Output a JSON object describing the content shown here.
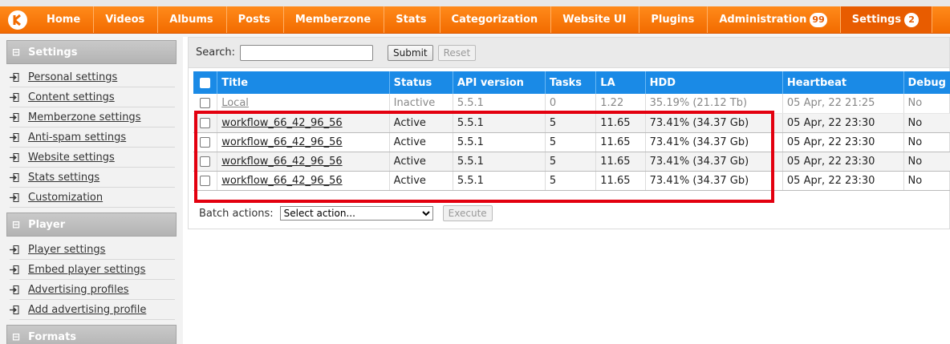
{
  "nav": {
    "items": [
      {
        "label": "Home"
      },
      {
        "label": "Videos"
      },
      {
        "label": "Albums"
      },
      {
        "label": "Posts"
      },
      {
        "label": "Memberzone"
      },
      {
        "label": "Stats"
      },
      {
        "label": "Categorization"
      },
      {
        "label": "Website UI"
      },
      {
        "label": "Plugins"
      },
      {
        "label": "Administration",
        "badge": "99"
      },
      {
        "label": "Settings",
        "badge": "2"
      }
    ]
  },
  "sidebar": {
    "sections": [
      {
        "title": "Settings",
        "toggle": "⊟",
        "links": [
          "Personal settings",
          "Content settings",
          "Memberzone settings",
          "Anti-spam settings",
          "Website settings",
          "Stats settings",
          "Customization"
        ]
      },
      {
        "title": "Player",
        "toggle": "⊟",
        "links": [
          "Player settings",
          "Embed player settings",
          "Advertising profiles",
          "Add advertising profile"
        ]
      },
      {
        "title": "Formats",
        "toggle": "⊟",
        "links": []
      }
    ]
  },
  "search": {
    "label": "Search:",
    "value": "",
    "submit": "Submit",
    "reset": "Reset"
  },
  "table": {
    "columns": [
      "Title",
      "Status",
      "API version",
      "Tasks",
      "LA",
      "HDD",
      "Heartbeat",
      "Debug"
    ],
    "rows": [
      {
        "title": "Local",
        "status": "Inactive",
        "api": "5.5.1",
        "tasks": "0",
        "la": "1.22",
        "hdd": "35.19% (21.12 Tb)",
        "heartbeat": "05 Apr, 22 21:25",
        "debug": "No"
      },
      {
        "title": "workflow_66_42_96_56",
        "status": "Active",
        "api": "5.5.1",
        "tasks": "5",
        "la": "11.65",
        "hdd": "73.41% (34.37 Gb)",
        "heartbeat": "05 Apr, 22 23:30",
        "debug": "No"
      },
      {
        "title": "workflow_66_42_96_56",
        "status": "Active",
        "api": "5.5.1",
        "tasks": "5",
        "la": "11.65",
        "hdd": "73.41% (34.37 Gb)",
        "heartbeat": "05 Apr, 22 23:30",
        "debug": "No"
      },
      {
        "title": "workflow_66_42_96_56",
        "status": "Active",
        "api": "5.5.1",
        "tasks": "5",
        "la": "11.65",
        "hdd": "73.41% (34.37 Gb)",
        "heartbeat": "05 Apr, 22 23:30",
        "debug": "No"
      },
      {
        "title": "workflow_66_42_96_56",
        "status": "Active",
        "api": "5.5.1",
        "tasks": "5",
        "la": "11.65",
        "hdd": "73.41% (34.37 Gb)",
        "heartbeat": "05 Apr, 22 23:30",
        "debug": "No"
      }
    ]
  },
  "batch": {
    "label": "Batch actions:",
    "select_value": "Select action...",
    "execute": "Execute"
  },
  "colors": {
    "nav": "#f26b00",
    "header": "#1a8ae6",
    "highlight": "#e3000f"
  }
}
